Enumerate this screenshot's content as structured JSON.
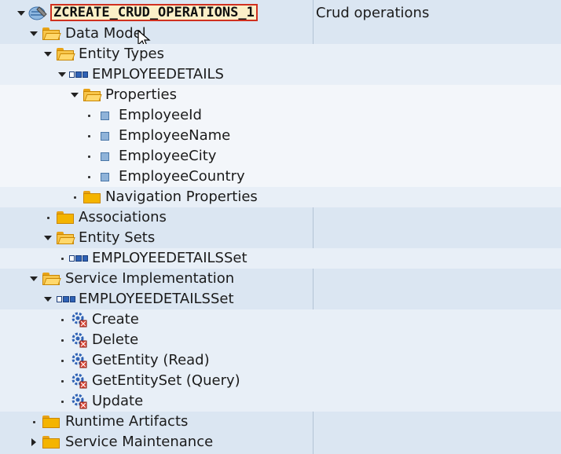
{
  "tree": {
    "root": {
      "label": "ZCREATE_CRUD_OPERATIONS_1",
      "description": "Crud operations"
    },
    "data_model": "Data Model",
    "entity_types": "Entity Types",
    "entity_employee": "EMPLOYEEDETAILS",
    "properties": "Properties",
    "property_items": [
      "EmployeeId",
      "EmployeeName",
      "EmployeeCity",
      "EmployeeCountry"
    ],
    "navigation_properties": "Navigation Properties",
    "associations": "Associations",
    "entity_sets": "Entity Sets",
    "entity_set_item": "EMPLOYEEDETAILSSet",
    "service_implementation": "Service Implementation",
    "service_entity_set": "EMPLOYEEDETAILSSet",
    "operations": [
      "Create",
      "Delete",
      "GetEntity (Read)",
      "GetEntitySet (Query)",
      "Update"
    ],
    "runtime_artifacts": "Runtime Artifacts",
    "service_maintenance": "Service Maintenance"
  },
  "colors": {
    "background": "#dbe6f2",
    "folder": "#f4b400",
    "root_highlight_border": "#d0301f"
  }
}
